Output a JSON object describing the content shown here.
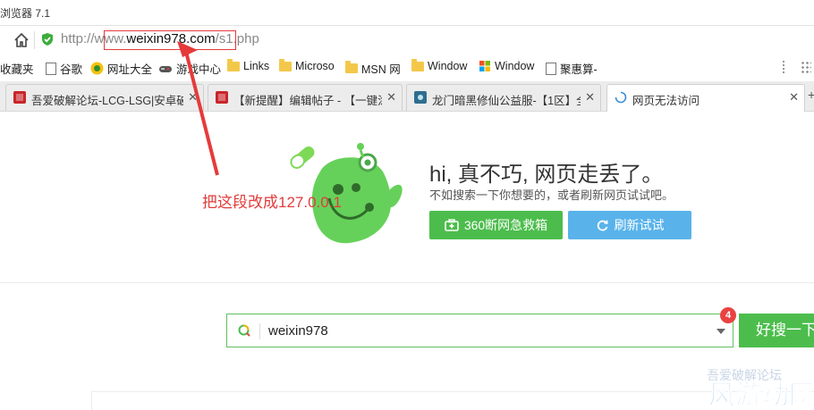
{
  "window": {
    "title": "浏览器 7.1"
  },
  "address_bar": {
    "url_prefix": "http://",
    "url_host_prefix": "www.",
    "url_host": "weixin978.com",
    "url_path": "/s1.php"
  },
  "bookmarks": [
    {
      "label": "收藏夹",
      "icon": "none"
    },
    {
      "label": "谷歌",
      "icon": "doc-icon"
    },
    {
      "label": "网址大全",
      "icon": "globe-icon"
    },
    {
      "label": "游戏中心",
      "icon": "gamepad-icon"
    },
    {
      "label": "Links",
      "icon": "folder-icon"
    },
    {
      "label": "Microso",
      "icon": "folder-icon"
    },
    {
      "label": "MSN 网",
      "icon": "folder-icon"
    },
    {
      "label": "Window",
      "icon": "folder-icon"
    },
    {
      "label": "Window",
      "icon": "windows-icon"
    },
    {
      "label": "聚惠算-",
      "icon": "doc-icon"
    }
  ],
  "tabs": [
    {
      "label": "吾爱破解论坛-LCG-LSG|安卓破",
      "close": "✕"
    },
    {
      "label": "【新提醒】编辑帖子 - 【一键涂",
      "close": "✕"
    },
    {
      "label": "龙门暗黑修仙公益服-【1区】全",
      "close": "✕"
    },
    {
      "label": "网页无法访问",
      "close": "✕"
    }
  ],
  "new_tab": "+",
  "error_page": {
    "headline": "hi, 真不巧, 网页走丢了。",
    "subtitle": "不如搜索一下你想要的，或者刷新网页试试吧。",
    "rescue_button": "360断网急救箱",
    "retry_button": "刷新试试"
  },
  "search": {
    "value": "weixin978",
    "badge": "4",
    "button": "好搜一下"
  },
  "annotation": {
    "text": "把这段改成127.0.0.1",
    "color": "#e23b3b"
  },
  "watermark": {
    "small_text": "吾爱破解论坛",
    "logo_text": "风游动网"
  },
  "colors": {
    "green": "#4cbd4c",
    "blue": "#59b3ea",
    "red": "#e53b3b"
  }
}
